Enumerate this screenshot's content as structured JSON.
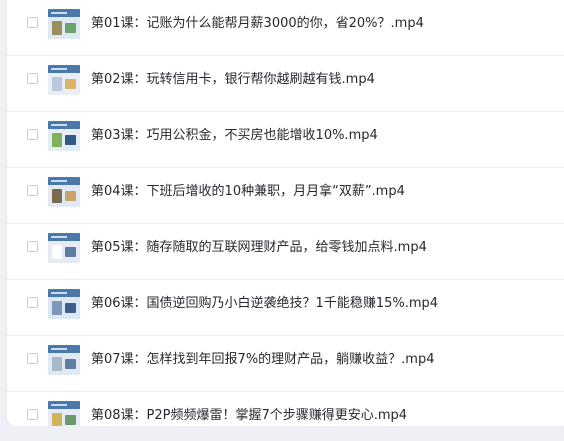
{
  "files": [
    {
      "name": "第01课：记账为什么能帮月薪3000的你，省20%？.mp4",
      "thumb": {
        "bg": "#dfe9f4",
        "accent": "#9a8f5c",
        "accent2": "#6aa36a"
      }
    },
    {
      "name": "第02课：玩转信用卡，银行帮你越刷越有钱.mp4",
      "thumb": {
        "bg": "#e9eef5",
        "accent": "#b7c9dd",
        "accent2": "#d9b46a"
      }
    },
    {
      "name": "第03课：巧用公积金，不买房也能增收10%.mp4",
      "thumb": {
        "bg": "#e4ecf5",
        "accent": "#7fb05a",
        "accent2": "#2f5a8a"
      }
    },
    {
      "name": "第04课：下班后增收的10种兼职，月月拿“双薪”.mp4",
      "thumb": {
        "bg": "#e2e9f3",
        "accent": "#7a6a50",
        "accent2": "#c9a36b"
      }
    },
    {
      "name": "第05课：随存随取的互联网理财产品，给零钱加点料.mp4",
      "thumb": {
        "bg": "#e6ebf3",
        "accent": "#ffffff",
        "accent2": "#5f7da3"
      }
    },
    {
      "name": "第06课：国债逆回购乃小白逆袭绝技？1千能稳赚15%.mp4",
      "thumb": {
        "bg": "#dde7f2",
        "accent": "#7d97b8",
        "accent2": "#3e5f8c"
      }
    },
    {
      "name": "第07课：怎样找到年回报7%的理财产品，躺赚收益？.mp4",
      "thumb": {
        "bg": "#e0e8f2",
        "accent": "#a9b9cc",
        "accent2": "#5e7ea5"
      }
    },
    {
      "name": "第08课：P2P频频爆雷！掌握7个步骤赚得更安心.mp4",
      "thumb": {
        "bg": "#e4ebf4",
        "accent": "#d2b35a",
        "accent2": "#6a9a6a"
      }
    }
  ],
  "colors": {
    "text": "#26292f",
    "divider": "#eceef2",
    "background": "#eef0f5"
  }
}
